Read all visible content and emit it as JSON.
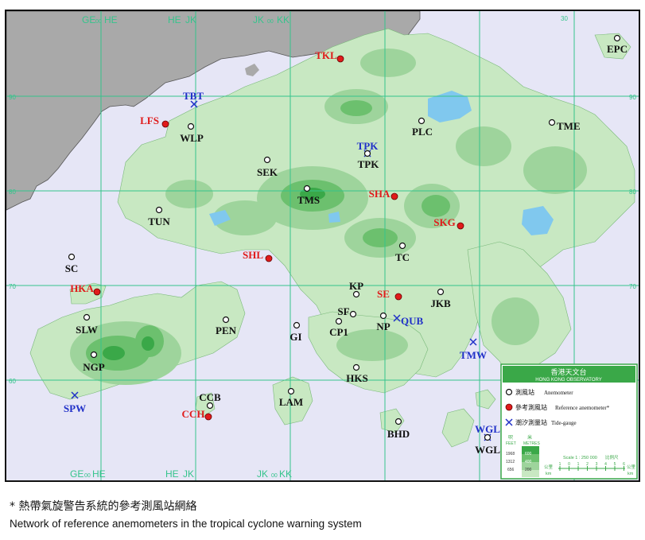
{
  "map": {
    "grid_top_labels": [
      "GE",
      "HE",
      "HE",
      "JK",
      "JK",
      "KK"
    ],
    "grid_top_sub": [
      "00",
      "00"
    ],
    "grid_right_numbers": [
      "30"
    ],
    "grid_side_numbers": [
      "90",
      "80",
      "70",
      "60"
    ],
    "grid_bottom_labels": [
      "GE",
      "HE",
      "HE",
      "JK",
      "JK",
      "KK"
    ],
    "grid_bottom_sub": [
      "00",
      "00"
    ],
    "colors": {
      "sea": "#e6e6f6",
      "grid": "#35c48c",
      "mainland": "#a9a9a9",
      "land_low": "#c8e8c2",
      "land_mid": "#9ed49c",
      "land_high": "#6cc06e",
      "land_top": "#3aa848",
      "reservoir": "#80c8ee",
      "reference_station": "#e01b1b",
      "reference_label": "#e01b1b",
      "tide_gauge": "#2030c8",
      "anemometer_label": "#111111"
    },
    "stations": [
      {
        "code": "EPC",
        "type": "anemometer"
      },
      {
        "code": "TKL",
        "type": "reference"
      },
      {
        "code": "TBT",
        "type": "tide"
      },
      {
        "code": "LFS",
        "type": "reference"
      },
      {
        "code": "WLP",
        "type": "anemometer"
      },
      {
        "code": "PLC",
        "type": "anemometer"
      },
      {
        "code": "TME",
        "type": "anemometer"
      },
      {
        "code": "TPK",
        "type": "tide"
      },
      {
        "code": "TPK",
        "type": "anemometer"
      },
      {
        "code": "SEK",
        "type": "anemometer"
      },
      {
        "code": "TMS",
        "type": "anemometer"
      },
      {
        "code": "SHA",
        "type": "reference"
      },
      {
        "code": "TUN",
        "type": "anemometer"
      },
      {
        "code": "SKG",
        "type": "reference"
      },
      {
        "code": "SHL",
        "type": "reference"
      },
      {
        "code": "TC",
        "type": "anemometer"
      },
      {
        "code": "SC",
        "type": "anemometer"
      },
      {
        "code": "HKA",
        "type": "reference"
      },
      {
        "code": "KP",
        "type": "anemometer"
      },
      {
        "code": "SE",
        "type": "reference"
      },
      {
        "code": "JKB",
        "type": "anemometer"
      },
      {
        "code": "SF",
        "type": "anemometer"
      },
      {
        "code": "QUB",
        "type": "tide"
      },
      {
        "code": "NP",
        "type": "anemometer"
      },
      {
        "code": "SLW",
        "type": "anemometer"
      },
      {
        "code": "PEN",
        "type": "anemometer"
      },
      {
        "code": "GI",
        "type": "anemometer"
      },
      {
        "code": "CP1",
        "type": "anemometer"
      },
      {
        "code": "TMW",
        "type": "tide"
      },
      {
        "code": "NGP",
        "type": "anemometer"
      },
      {
        "code": "HKS",
        "type": "anemometer"
      },
      {
        "code": "CCB",
        "type": "anemometer"
      },
      {
        "code": "LAM",
        "type": "anemometer"
      },
      {
        "code": "SPW",
        "type": "tide"
      },
      {
        "code": "CCH",
        "type": "reference"
      },
      {
        "code": "BHD",
        "type": "anemometer"
      },
      {
        "code": "WGL",
        "type": "tide"
      },
      {
        "code": "WGL",
        "type": "anemometer"
      }
    ]
  },
  "legend": {
    "title_zh": "香港天文台",
    "title_en": "HONG KONG OBSERVATORY",
    "items": [
      {
        "symbol": "anemometer",
        "zh": "測風站",
        "en": "Anemometer"
      },
      {
        "symbol": "reference",
        "zh": "參考測風站",
        "en": "Reference anemometer*"
      },
      {
        "symbol": "tide",
        "zh": "潮汐測量站",
        "en": "Tide-gauge"
      }
    ],
    "elevation_header": [
      "呎",
      "米",
      "FEET",
      "METRES"
    ],
    "elevation_feet": [
      "1968",
      "1312",
      "656"
    ],
    "elevation_metres": [
      "600",
      "400",
      "200"
    ],
    "scale_text": "Scale 1 : 250 000",
    "scale_zh": "比例尺",
    "scale_unit_zh": "公里",
    "scale_unit": "km",
    "scale_ticks": [
      "1",
      "0",
      "1",
      "2",
      "3",
      "4",
      "5",
      "6"
    ]
  },
  "caption": {
    "zh": "* 熱帶氣旋警告系統的參考測風站網絡",
    "en": "Network of reference anemometers in the tropical cyclone warning system"
  }
}
